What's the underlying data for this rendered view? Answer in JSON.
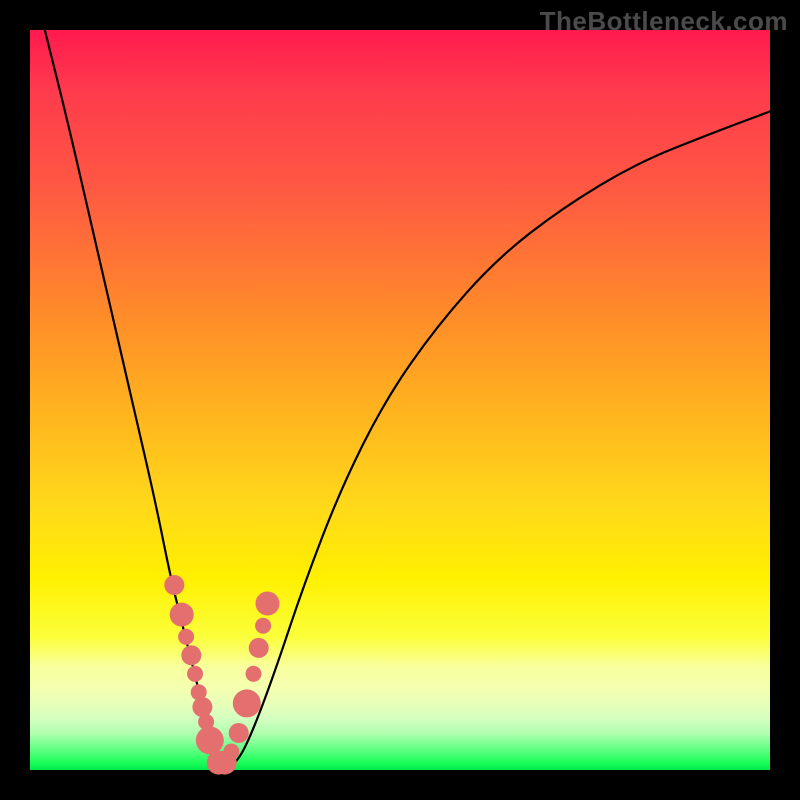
{
  "watermark": "TheBottleneck.com",
  "colors": {
    "background": "#000000",
    "gradient_top": "#ff1a4d",
    "gradient_mid1": "#ff8a2a",
    "gradient_mid2": "#ffd81a",
    "gradient_mid3": "#fbff3a",
    "gradient_bottom": "#00e84a",
    "curve": "#000000",
    "marker": "#e46f6f"
  },
  "chart_data": {
    "type": "line",
    "title": "",
    "xlabel": "",
    "ylabel": "",
    "xlim": [
      0,
      100
    ],
    "ylim": [
      0,
      100
    ],
    "legend": null,
    "annotations": [
      "TheBottleneck.com"
    ],
    "series": [
      {
        "name": "bottleneck-curve",
        "x": [
          2,
          5,
          8,
          11,
          14,
          17,
          19,
          21,
          23,
          24,
          25,
          26,
          28,
          30,
          33,
          37,
          42,
          48,
          55,
          63,
          72,
          82,
          92,
          100
        ],
        "values": [
          100,
          88,
          75,
          62,
          49,
          36,
          26,
          18,
          10,
          5,
          1,
          0,
          1,
          5,
          13,
          25,
          38,
          50,
          60,
          69,
          76,
          82,
          86,
          89
        ]
      }
    ],
    "markers": {
      "name": "highlight-points",
      "x": [
        19.5,
        20.5,
        21.1,
        21.8,
        22.3,
        22.8,
        23.3,
        23.8,
        24.3,
        25.5,
        26.3,
        27.2,
        28.2,
        29.3,
        30.2,
        30.9,
        31.5,
        32.1
      ],
      "values": [
        25.0,
        21.0,
        18.0,
        15.5,
        13.0,
        10.5,
        8.5,
        6.5,
        4.0,
        1.0,
        1.0,
        2.5,
        5.0,
        9.0,
        13.0,
        16.5,
        19.5,
        22.5
      ],
      "sizes": [
        5,
        6,
        4,
        5,
        4,
        4,
        5,
        4,
        7,
        6,
        6,
        4,
        5,
        7,
        4,
        5,
        4,
        6
      ]
    }
  }
}
